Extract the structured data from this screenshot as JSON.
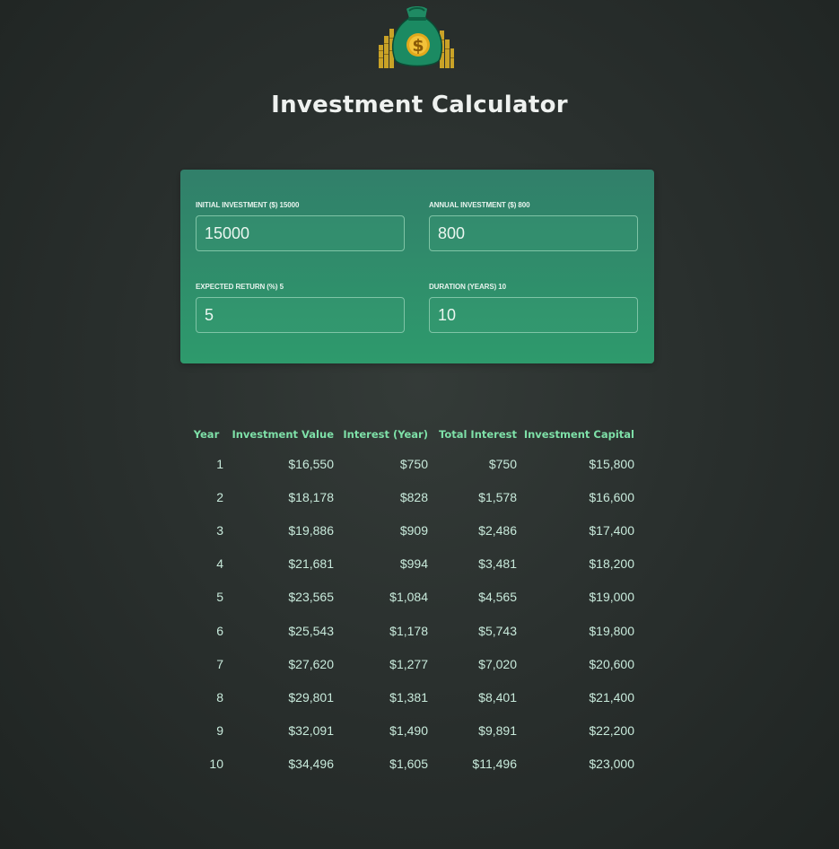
{
  "app": {
    "title": "Investment Calculator",
    "logo_icon": "money-bag-dollar-icon"
  },
  "inputs": {
    "initial_investment": {
      "label": "Initial Investment ($) 15000",
      "value": "15000"
    },
    "annual_investment": {
      "label": "Annual Investment ($) 800",
      "value": "800"
    },
    "expected_return": {
      "label": "Expected Return (%) 5",
      "value": "5"
    },
    "duration": {
      "label": "Duration (Years) 10",
      "value": "10"
    }
  },
  "table": {
    "headers": [
      "Year",
      "Investment Value",
      "Interest (Year)",
      "Total Interest",
      "Investment Capital"
    ],
    "rows": [
      [
        "1",
        "$16,550",
        "$750",
        "$750",
        "$15,800"
      ],
      [
        "2",
        "$18,178",
        "$828",
        "$1,578",
        "$16,600"
      ],
      [
        "3",
        "$19,886",
        "$909",
        "$2,486",
        "$17,400"
      ],
      [
        "4",
        "$21,681",
        "$994",
        "$3,481",
        "$18,200"
      ],
      [
        "5",
        "$23,565",
        "$1,084",
        "$4,565",
        "$19,000"
      ],
      [
        "6",
        "$25,543",
        "$1,178",
        "$5,743",
        "$19,800"
      ],
      [
        "7",
        "$27,620",
        "$1,277",
        "$7,020",
        "$20,600"
      ],
      [
        "8",
        "$29,801",
        "$1,381",
        "$8,401",
        "$21,400"
      ],
      [
        "9",
        "$32,091",
        "$1,490",
        "$9,891",
        "$22,200"
      ],
      [
        "10",
        "$34,496",
        "$1,605",
        "$11,496",
        "$23,000"
      ]
    ]
  },
  "colors": {
    "background": "#2a302e",
    "card_top": "#317f6a",
    "card_bottom": "#2e9a6c",
    "header_text": "#7ee0a8",
    "cell_text": "#c8eadb"
  }
}
